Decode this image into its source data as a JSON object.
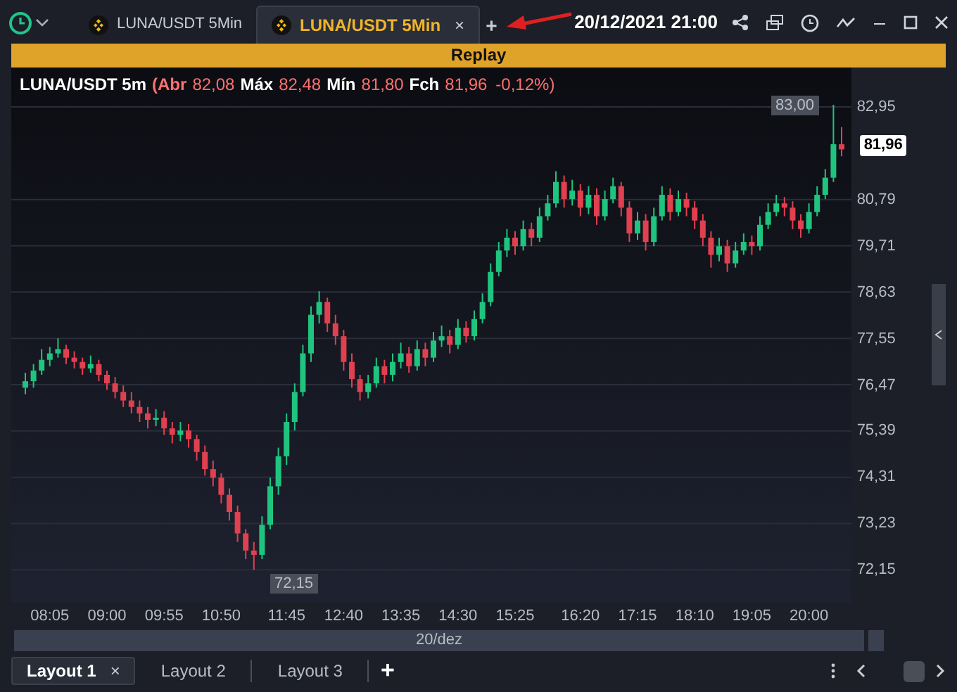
{
  "toolbar": {
    "tabs": [
      {
        "label": "LUNA/USDT 5Min",
        "selected": false
      },
      {
        "label": "LUNA/USDT 5Min",
        "selected": true
      }
    ],
    "close_tab": "×",
    "add_tab": "+",
    "datetime": "20/12/2021 21:00"
  },
  "replay_bar": {
    "label": "Replay"
  },
  "chart": {
    "legend": {
      "symbol": "LUNA/USDT 5m",
      "open_label": "(Abr",
      "open": "82,08",
      "high_label": "Máx",
      "high": "82,48",
      "low_label": "Mín",
      "low": "81,80",
      "close_label": "Fch",
      "close": "81,96",
      "change": "-0,12%)"
    },
    "last_price": "81,96",
    "high_marker": "83,00",
    "low_marker": "72,15",
    "date": "20/dez",
    "chart_data": {
      "type": "candlestick",
      "grid": true,
      "ylim": [
        71.4,
        83.87
      ],
      "yticks": [
        {
          "value": 82.95,
          "label": "82,95"
        },
        {
          "value": 80.79,
          "label": "80,79"
        },
        {
          "value": 79.71,
          "label": "79,71"
        },
        {
          "value": 78.63,
          "label": "78,63"
        },
        {
          "value": 77.55,
          "label": "77,55"
        },
        {
          "value": 76.47,
          "label": "76,47"
        },
        {
          "value": 75.39,
          "label": "75,39"
        },
        {
          "value": 74.31,
          "label": "74,31"
        },
        {
          "value": 73.23,
          "label": "73,23"
        },
        {
          "value": 72.15,
          "label": "72,15"
        }
      ],
      "categories": [
        null,
        null,
        null,
        "08:05",
        null,
        null,
        null,
        null,
        null,
        null,
        "09:00",
        null,
        null,
        null,
        null,
        null,
        null,
        "09:55",
        null,
        null,
        null,
        null,
        null,
        null,
        "10:50",
        null,
        null,
        null,
        null,
        null,
        null,
        null,
        "11:45",
        null,
        null,
        null,
        null,
        null,
        null,
        "12:40",
        null,
        null,
        null,
        null,
        null,
        null,
        "13:35",
        null,
        null,
        null,
        null,
        null,
        null,
        "14:30",
        null,
        null,
        null,
        null,
        null,
        null,
        "15:25",
        null,
        null,
        null,
        null,
        null,
        null,
        null,
        "16:20",
        null,
        null,
        null,
        null,
        null,
        null,
        "17:15",
        null,
        null,
        null,
        null,
        null,
        null,
        "18:10",
        null,
        null,
        null,
        null,
        null,
        null,
        "19:05",
        null,
        null,
        null,
        null,
        null,
        null,
        "20:00",
        null,
        null,
        null,
        null
      ],
      "ohlc": [
        [
          76.4,
          76.75,
          76.25,
          76.55
        ],
        [
          76.55,
          76.95,
          76.4,
          76.8
        ],
        [
          76.8,
          77.3,
          76.7,
          77.05
        ],
        [
          77.05,
          77.35,
          76.9,
          77.2
        ],
        [
          77.2,
          77.55,
          77.1,
          77.3
        ],
        [
          77.3,
          77.4,
          76.95,
          77.1
        ],
        [
          77.1,
          77.25,
          76.85,
          77.0
        ],
        [
          77.0,
          77.1,
          76.7,
          76.85
        ],
        [
          76.85,
          77.15,
          76.75,
          76.95
        ],
        [
          76.95,
          77.05,
          76.55,
          76.7
        ],
        [
          76.7,
          76.8,
          76.35,
          76.5
        ],
        [
          76.5,
          76.65,
          76.15,
          76.3
        ],
        [
          76.3,
          76.45,
          75.95,
          76.1
        ],
        [
          76.1,
          76.3,
          75.8,
          75.95
        ],
        [
          75.95,
          76.1,
          75.6,
          75.8
        ],
        [
          75.8,
          75.95,
          75.45,
          75.65
        ],
        [
          75.65,
          75.9,
          75.5,
          75.7
        ],
        [
          75.7,
          75.85,
          75.3,
          75.45
        ],
        [
          75.45,
          75.6,
          75.1,
          75.3
        ],
        [
          75.3,
          75.6,
          75.15,
          75.4
        ],
        [
          75.4,
          75.55,
          75.0,
          75.2
        ],
        [
          75.2,
          75.3,
          74.7,
          74.9
        ],
        [
          74.9,
          75.05,
          74.35,
          74.5
        ],
        [
          74.5,
          74.7,
          74.1,
          74.3
        ],
        [
          74.3,
          74.4,
          73.7,
          73.9
        ],
        [
          73.9,
          74.05,
          73.3,
          73.5
        ],
        [
          73.5,
          73.65,
          72.8,
          73.0
        ],
        [
          73.0,
          73.1,
          72.4,
          72.6
        ],
        [
          72.6,
          72.8,
          72.15,
          72.5
        ],
        [
          72.5,
          73.4,
          72.4,
          73.2
        ],
        [
          73.2,
          74.3,
          73.1,
          74.1
        ],
        [
          74.1,
          75.0,
          73.9,
          74.8
        ],
        [
          74.8,
          75.8,
          74.6,
          75.6
        ],
        [
          75.6,
          76.5,
          75.4,
          76.3
        ],
        [
          76.3,
          77.4,
          76.2,
          77.2
        ],
        [
          77.2,
          78.3,
          77.0,
          78.1
        ],
        [
          78.1,
          78.65,
          77.9,
          78.4
        ],
        [
          78.4,
          78.5,
          77.7,
          77.9
        ],
        [
          77.9,
          78.1,
          77.4,
          77.6
        ],
        [
          77.6,
          77.75,
          76.8,
          77.0
        ],
        [
          77.0,
          77.2,
          76.4,
          76.6
        ],
        [
          76.6,
          76.7,
          76.1,
          76.3
        ],
        [
          76.3,
          76.7,
          76.15,
          76.5
        ],
        [
          76.5,
          77.1,
          76.4,
          76.9
        ],
        [
          76.9,
          77.05,
          76.5,
          76.7
        ],
        [
          76.7,
          77.2,
          76.55,
          77.0
        ],
        [
          77.0,
          77.45,
          76.85,
          77.2
        ],
        [
          77.2,
          77.35,
          76.75,
          76.9
        ],
        [
          76.9,
          77.5,
          76.8,
          77.3
        ],
        [
          77.3,
          77.45,
          76.9,
          77.1
        ],
        [
          77.1,
          77.7,
          77.0,
          77.5
        ],
        [
          77.5,
          77.85,
          77.35,
          77.6
        ],
        [
          77.6,
          77.75,
          77.2,
          77.4
        ],
        [
          77.4,
          78.0,
          77.3,
          77.8
        ],
        [
          77.8,
          77.95,
          77.45,
          77.6
        ],
        [
          77.6,
          78.2,
          77.5,
          78.0
        ],
        [
          78.0,
          78.6,
          77.9,
          78.4
        ],
        [
          78.4,
          79.3,
          78.3,
          79.1
        ],
        [
          79.1,
          79.8,
          79.0,
          79.6
        ],
        [
          79.6,
          80.1,
          79.45,
          79.9
        ],
        [
          79.9,
          80.05,
          79.5,
          79.7
        ],
        [
          79.7,
          80.3,
          79.6,
          80.1
        ],
        [
          80.1,
          80.25,
          79.7,
          79.9
        ],
        [
          79.9,
          80.6,
          79.8,
          80.4
        ],
        [
          80.4,
          80.9,
          80.3,
          80.7
        ],
        [
          80.7,
          81.45,
          80.6,
          81.2
        ],
        [
          81.2,
          81.35,
          80.6,
          80.8
        ],
        [
          80.8,
          81.25,
          80.65,
          81.0
        ],
        [
          81.0,
          81.15,
          80.4,
          80.6
        ],
        [
          80.6,
          81.1,
          80.45,
          80.9
        ],
        [
          80.9,
          81.05,
          80.2,
          80.4
        ],
        [
          80.4,
          81.0,
          80.3,
          80.8
        ],
        [
          80.8,
          81.3,
          80.7,
          81.1
        ],
        [
          81.1,
          81.2,
          80.4,
          80.6
        ],
        [
          80.6,
          80.75,
          79.8,
          80.0
        ],
        [
          80.0,
          80.5,
          79.85,
          80.3
        ],
        [
          80.3,
          80.45,
          79.6,
          79.8
        ],
        [
          79.8,
          80.6,
          79.7,
          80.4
        ],
        [
          80.4,
          81.1,
          80.3,
          80.9
        ],
        [
          80.9,
          81.05,
          80.3,
          80.5
        ],
        [
          80.5,
          81.0,
          80.4,
          80.8
        ],
        [
          80.8,
          80.95,
          80.4,
          80.6
        ],
        [
          80.6,
          80.75,
          80.1,
          80.3
        ],
        [
          80.3,
          80.45,
          79.7,
          79.9
        ],
        [
          79.9,
          80.05,
          79.2,
          79.5
        ],
        [
          79.5,
          79.9,
          79.35,
          79.7
        ],
        [
          79.7,
          79.85,
          79.1,
          79.3
        ],
        [
          79.3,
          79.8,
          79.2,
          79.6
        ],
        [
          79.6,
          80.0,
          79.5,
          79.8
        ],
        [
          79.8,
          79.95,
          79.5,
          79.7
        ],
        [
          79.7,
          80.4,
          79.6,
          80.2
        ],
        [
          80.2,
          80.7,
          80.1,
          80.5
        ],
        [
          80.5,
          80.9,
          80.4,
          80.7
        ],
        [
          80.7,
          80.85,
          80.4,
          80.6
        ],
        [
          80.6,
          80.75,
          80.1,
          80.3
        ],
        [
          80.3,
          80.45,
          79.9,
          80.1
        ],
        [
          80.1,
          80.7,
          80.0,
          80.5
        ],
        [
          80.5,
          81.1,
          80.4,
          80.9
        ],
        [
          80.9,
          81.5,
          80.8,
          81.3
        ],
        [
          81.3,
          83.0,
          81.2,
          82.08
        ],
        [
          82.08,
          82.48,
          81.8,
          81.96
        ]
      ]
    }
  },
  "layouts": {
    "tabs": [
      {
        "label": "Layout 1",
        "selected": true
      },
      {
        "label": "Layout 2",
        "selected": false
      },
      {
        "label": "Layout 3",
        "selected": false
      }
    ],
    "close_tab": "×",
    "add_tab": "+"
  }
}
